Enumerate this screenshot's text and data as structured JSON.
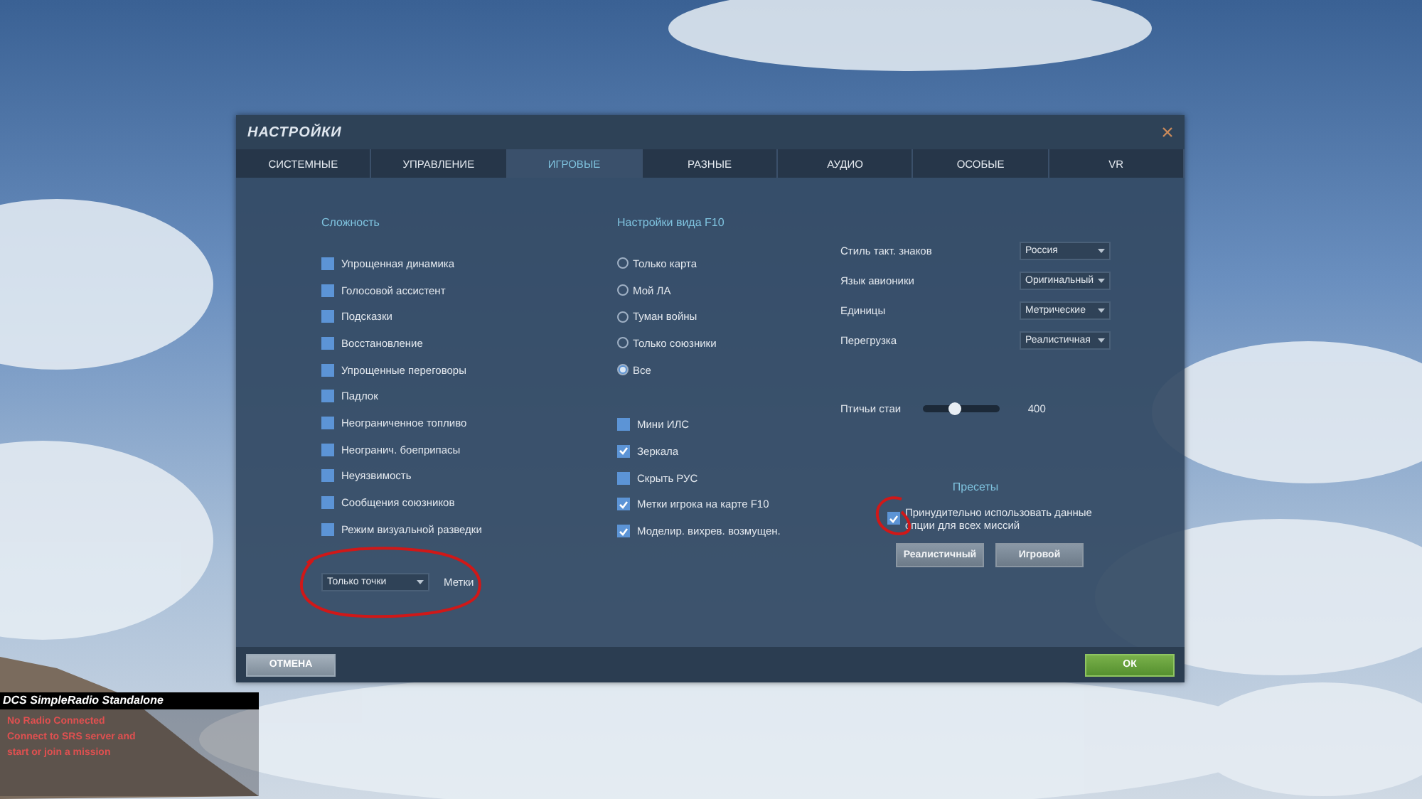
{
  "window": {
    "title": "НАСТРОЙКИ"
  },
  "tabs": [
    {
      "label": "СИСТЕМНЫЕ",
      "selected": false
    },
    {
      "label": "УПРАВЛЕНИЕ",
      "selected": false
    },
    {
      "label": "ИГРОВЫЕ",
      "selected": true
    },
    {
      "label": "РАЗНЫЕ",
      "selected": false
    },
    {
      "label": "АУДИО",
      "selected": false
    },
    {
      "label": "ОСОБЫЕ",
      "selected": false
    },
    {
      "label": "VR",
      "selected": false
    }
  ],
  "difficulty": {
    "heading": "Сложность",
    "options": [
      {
        "label": "Упрощенная динамика",
        "checked": false
      },
      {
        "label": "Голосовой ассистент",
        "checked": false
      },
      {
        "label": "Подсказки",
        "checked": false
      },
      {
        "label": "Восстановление",
        "checked": false
      },
      {
        "label": "Упрощенные переговоры",
        "checked": false
      },
      {
        "label": "Падлок",
        "checked": false
      },
      {
        "label": "Неограниченное топливо",
        "checked": false
      },
      {
        "label": "Неогранич. боеприпасы",
        "checked": false
      },
      {
        "label": "Неуязвимость",
        "checked": false
      },
      {
        "label": "Сообщения союзников",
        "checked": false
      },
      {
        "label": "Режим визуальной разведки",
        "checked": false
      }
    ],
    "labels_dropdown": {
      "value": "Только точки",
      "label": "Метки"
    }
  },
  "f10_view": {
    "heading": "Настройки вида F10",
    "views": [
      {
        "label": "Только карта",
        "selected": false
      },
      {
        "label": "Мой ЛА",
        "selected": false
      },
      {
        "label": "Туман войны",
        "selected": false
      },
      {
        "label": "Только союзники",
        "selected": false
      },
      {
        "label": "Все",
        "selected": true
      }
    ],
    "options": [
      {
        "label": "Мини ИЛС",
        "checked": false
      },
      {
        "label": "Зеркала",
        "checked": true
      },
      {
        "label": "Скрыть РУС",
        "checked": false
      },
      {
        "label": "Метки игрока на карте F10",
        "checked": true
      },
      {
        "label": "Моделир. вихрев. возмущен.",
        "checked": true
      }
    ]
  },
  "settings": [
    {
      "label": "Стиль такт. знаков",
      "value": "Россия"
    },
    {
      "label": "Язык авионики",
      "value": "Оригинальный"
    },
    {
      "label": "Единицы",
      "value": "Метрические"
    },
    {
      "label": "Перегрузка",
      "value": "Реалистичная"
    }
  ],
  "bird_slider": {
    "label": "Птичьи стаи",
    "level": 0.41,
    "reading": "400"
  },
  "presets": {
    "heading": "Пресеты",
    "force_option": {
      "label": "Принудительно использовать данные опции для всех миссий",
      "checked": true
    },
    "buttons": [
      "Реалистичный",
      "Игровой"
    ]
  },
  "footer": {
    "cancel": "ОТМЕНА",
    "ok": "ОК"
  },
  "srs_overlay": {
    "title": "DCS SimpleRadio Standalone",
    "lines": [
      "No Radio Connected",
      "Connect to SRS server and",
      "start or join a mission"
    ]
  }
}
